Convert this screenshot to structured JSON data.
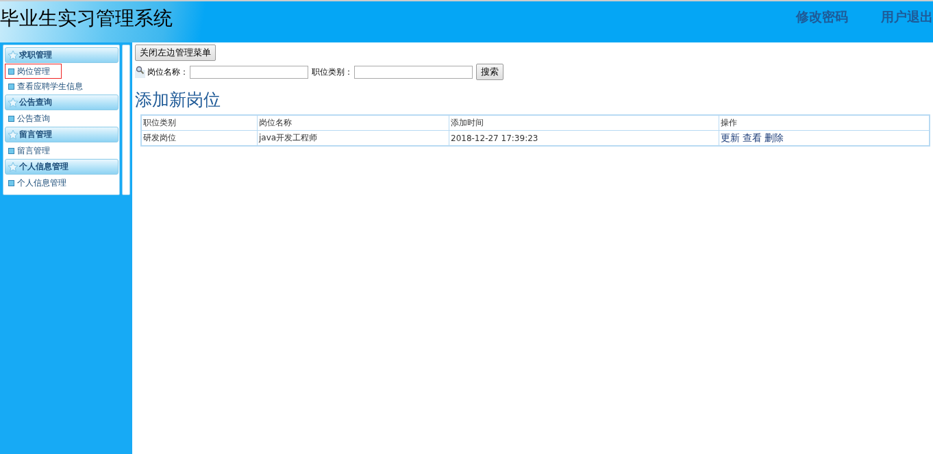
{
  "header": {
    "title": "毕业生实习管理系统",
    "links": [
      "修改密码",
      "用户退出"
    ]
  },
  "sidebar": {
    "groups": [
      {
        "title": "求职管理",
        "items": [
          {
            "label": "岗位管理",
            "selected": true
          },
          {
            "label": "查看应聘学生信息",
            "selected": false
          }
        ]
      },
      {
        "title": "公告查询",
        "items": [
          {
            "label": "公告查询",
            "selected": false
          }
        ]
      },
      {
        "title": "留言管理",
        "items": [
          {
            "label": "留言管理",
            "selected": false
          }
        ]
      },
      {
        "title": "个人信息管理",
        "items": [
          {
            "label": "个人信息管理",
            "selected": false
          }
        ]
      }
    ]
  },
  "toggle_button": "关闭左边管理菜单",
  "search": {
    "fields": [
      {
        "label": "岗位名称："
      },
      {
        "label": "职位类别："
      }
    ],
    "button": "搜索"
  },
  "heading": "添加新岗位",
  "table": {
    "columns": [
      "职位类别",
      "岗位名称",
      "添加时间",
      "操作"
    ],
    "rows": [
      {
        "cells": [
          "研发岗位",
          "java开发工程师",
          "2018-12-27 17:39:23"
        ],
        "actions": [
          "更新",
          "查看",
          "删除"
        ]
      }
    ]
  }
}
